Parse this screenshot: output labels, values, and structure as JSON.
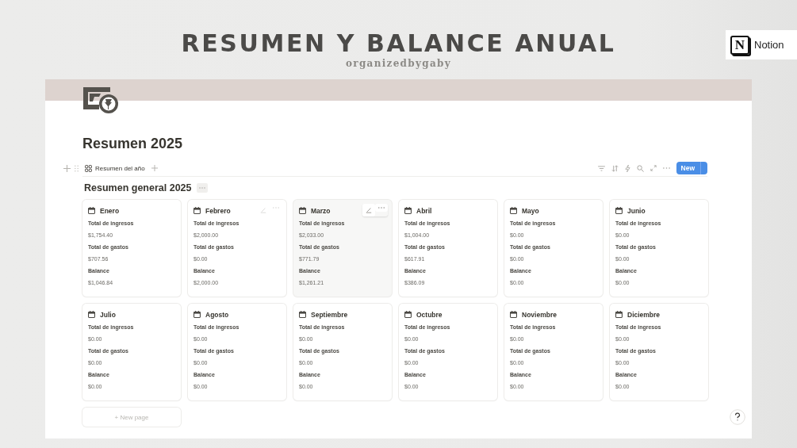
{
  "header": {
    "title": "RESUMEN Y BALANCE ANUAL",
    "subtitle": "organizedbygaby"
  },
  "badge": {
    "logo_letter": "N",
    "label": "Notion"
  },
  "page": {
    "title": "Resumen 2025",
    "view_tab": {
      "label": "Resumen del año",
      "selected": true
    },
    "new_button": {
      "label": "New"
    },
    "section_title": "Resumen general 2025",
    "cards": [
      {
        "name": "Enero",
        "highlighted": false,
        "actions_visible": false,
        "fields": [
          {
            "label": "Total de ingresos",
            "value": "$1,754.40"
          },
          {
            "label": "Total de gastos",
            "value": "$707.56"
          },
          {
            "label": "Balance",
            "value": "$1,046.84"
          }
        ]
      },
      {
        "name": "Febrero",
        "highlighted": false,
        "actions_visible": true,
        "fields": [
          {
            "label": "Total de ingresos",
            "value": "$2,000.00"
          },
          {
            "label": "Total de gastos",
            "value": "$0.00"
          },
          {
            "label": "Balance",
            "value": "$2,000.00"
          }
        ]
      },
      {
        "name": "Marzo",
        "highlighted": true,
        "actions_visible": true,
        "fields": [
          {
            "label": "Total de ingresos",
            "value": "$2,033.00"
          },
          {
            "label": "Total de gastos",
            "value": "$771.79"
          },
          {
            "label": "Balance",
            "value": "$1,261.21"
          }
        ]
      },
      {
        "name": "Abril",
        "highlighted": false,
        "actions_visible": false,
        "fields": [
          {
            "label": "Total de ingresos",
            "value": "$1,004.00"
          },
          {
            "label": "Total de gastos",
            "value": "$617.91"
          },
          {
            "label": "Balance",
            "value": "$386.09"
          }
        ]
      },
      {
        "name": "Mayo",
        "highlighted": false,
        "actions_visible": false,
        "fields": [
          {
            "label": "Total de ingresos",
            "value": "$0.00"
          },
          {
            "label": "Total de gastos",
            "value": "$0.00"
          },
          {
            "label": "Balance",
            "value": "$0.00"
          }
        ]
      },
      {
        "name": "Junio",
        "highlighted": false,
        "actions_visible": false,
        "fields": [
          {
            "label": "Total de ingresos",
            "value": "$0.00"
          },
          {
            "label": "Total de gastos",
            "value": "$0.00"
          },
          {
            "label": "Balance",
            "value": "$0.00"
          }
        ]
      },
      {
        "name": "Julio",
        "highlighted": false,
        "actions_visible": false,
        "fields": [
          {
            "label": "Total de ingresos",
            "value": "$0.00"
          },
          {
            "label": "Total de gastos",
            "value": "$0.00"
          },
          {
            "label": "Balance",
            "value": "$0.00"
          }
        ]
      },
      {
        "name": "Agosto",
        "highlighted": false,
        "actions_visible": false,
        "fields": [
          {
            "label": "Total de ingresos",
            "value": "$0.00"
          },
          {
            "label": "Total de gastos",
            "value": "$0.00"
          },
          {
            "label": "Balance",
            "value": "$0.00"
          }
        ]
      },
      {
        "name": "Septiembre",
        "highlighted": false,
        "actions_visible": false,
        "fields": [
          {
            "label": "Total de ingresos",
            "value": "$0.00"
          },
          {
            "label": "Total de gastos",
            "value": "$0.00"
          },
          {
            "label": "Balance",
            "value": "$0.00"
          }
        ]
      },
      {
        "name": "Octubre",
        "highlighted": false,
        "actions_visible": false,
        "fields": [
          {
            "label": "Total de ingresos",
            "value": "$0.00"
          },
          {
            "label": "Total de gastos",
            "value": "$0.00"
          },
          {
            "label": "Balance",
            "value": "$0.00"
          }
        ]
      },
      {
        "name": "Noviembre",
        "highlighted": false,
        "actions_visible": false,
        "fields": [
          {
            "label": "Total de ingresos",
            "value": "$0.00"
          },
          {
            "label": "Total de gastos",
            "value": "$0.00"
          },
          {
            "label": "Balance",
            "value": "$0.00"
          }
        ]
      },
      {
        "name": "Diciembre",
        "highlighted": false,
        "actions_visible": false,
        "fields": [
          {
            "label": "Total de ingresos",
            "value": "$0.00"
          },
          {
            "label": "Total de gastos",
            "value": "$0.00"
          },
          {
            "label": "Balance",
            "value": "$0.00"
          }
        ]
      }
    ],
    "new_page": {
      "label": "+ New page"
    }
  }
}
